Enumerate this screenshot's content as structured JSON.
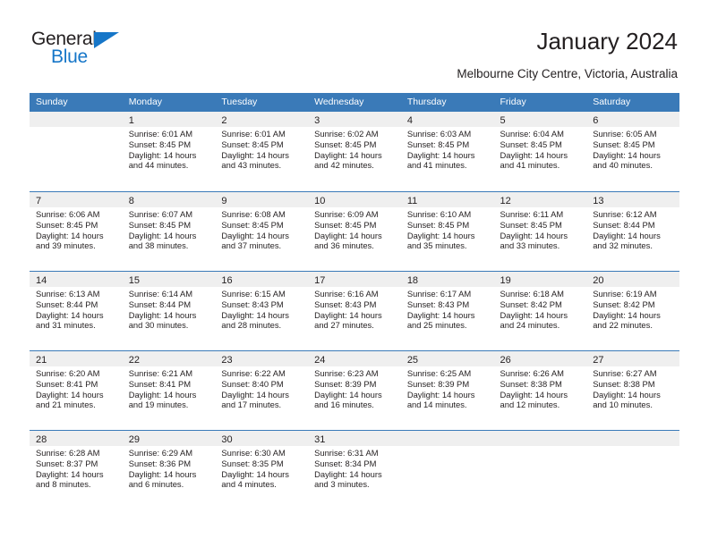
{
  "logo": {
    "word1": "General",
    "word2": "Blue",
    "triangle_color": "#1676c8",
    "word1_color": "#231f20",
    "word2_color": "#1676c8"
  },
  "header": {
    "title": "January 2024",
    "subtitle": "Melbourne City Centre, Victoria, Australia"
  },
  "theme": {
    "header_bar_color": "#3a7ab8",
    "daynum_band_color": "#efefef",
    "text_color": "#231f20",
    "divider_color": "#3a7ab8"
  },
  "calendar": {
    "weekday_headers": [
      "Sunday",
      "Monday",
      "Tuesday",
      "Wednesday",
      "Thursday",
      "Friday",
      "Saturday"
    ],
    "weeks": [
      [
        {
          "day": "",
          "sunrise": "",
          "sunset": "",
          "daylight_line1": "",
          "daylight_line2": "",
          "empty": true
        },
        {
          "day": "1",
          "sunrise": "Sunrise: 6:01 AM",
          "sunset": "Sunset: 8:45 PM",
          "daylight_line1": "Daylight: 14 hours",
          "daylight_line2": "and 44 minutes."
        },
        {
          "day": "2",
          "sunrise": "Sunrise: 6:01 AM",
          "sunset": "Sunset: 8:45 PM",
          "daylight_line1": "Daylight: 14 hours",
          "daylight_line2": "and 43 minutes."
        },
        {
          "day": "3",
          "sunrise": "Sunrise: 6:02 AM",
          "sunset": "Sunset: 8:45 PM",
          "daylight_line1": "Daylight: 14 hours",
          "daylight_line2": "and 42 minutes."
        },
        {
          "day": "4",
          "sunrise": "Sunrise: 6:03 AM",
          "sunset": "Sunset: 8:45 PM",
          "daylight_line1": "Daylight: 14 hours",
          "daylight_line2": "and 41 minutes."
        },
        {
          "day": "5",
          "sunrise": "Sunrise: 6:04 AM",
          "sunset": "Sunset: 8:45 PM",
          "daylight_line1": "Daylight: 14 hours",
          "daylight_line2": "and 41 minutes."
        },
        {
          "day": "6",
          "sunrise": "Sunrise: 6:05 AM",
          "sunset": "Sunset: 8:45 PM",
          "daylight_line1": "Daylight: 14 hours",
          "daylight_line2": "and 40 minutes."
        }
      ],
      [
        {
          "day": "7",
          "sunrise": "Sunrise: 6:06 AM",
          "sunset": "Sunset: 8:45 PM",
          "daylight_line1": "Daylight: 14 hours",
          "daylight_line2": "and 39 minutes."
        },
        {
          "day": "8",
          "sunrise": "Sunrise: 6:07 AM",
          "sunset": "Sunset: 8:45 PM",
          "daylight_line1": "Daylight: 14 hours",
          "daylight_line2": "and 38 minutes."
        },
        {
          "day": "9",
          "sunrise": "Sunrise: 6:08 AM",
          "sunset": "Sunset: 8:45 PM",
          "daylight_line1": "Daylight: 14 hours",
          "daylight_line2": "and 37 minutes."
        },
        {
          "day": "10",
          "sunrise": "Sunrise: 6:09 AM",
          "sunset": "Sunset: 8:45 PM",
          "daylight_line1": "Daylight: 14 hours",
          "daylight_line2": "and 36 minutes."
        },
        {
          "day": "11",
          "sunrise": "Sunrise: 6:10 AM",
          "sunset": "Sunset: 8:45 PM",
          "daylight_line1": "Daylight: 14 hours",
          "daylight_line2": "and 35 minutes."
        },
        {
          "day": "12",
          "sunrise": "Sunrise: 6:11 AM",
          "sunset": "Sunset: 8:45 PM",
          "daylight_line1": "Daylight: 14 hours",
          "daylight_line2": "and 33 minutes."
        },
        {
          "day": "13",
          "sunrise": "Sunrise: 6:12 AM",
          "sunset": "Sunset: 8:44 PM",
          "daylight_line1": "Daylight: 14 hours",
          "daylight_line2": "and 32 minutes."
        }
      ],
      [
        {
          "day": "14",
          "sunrise": "Sunrise: 6:13 AM",
          "sunset": "Sunset: 8:44 PM",
          "daylight_line1": "Daylight: 14 hours",
          "daylight_line2": "and 31 minutes."
        },
        {
          "day": "15",
          "sunrise": "Sunrise: 6:14 AM",
          "sunset": "Sunset: 8:44 PM",
          "daylight_line1": "Daylight: 14 hours",
          "daylight_line2": "and 30 minutes."
        },
        {
          "day": "16",
          "sunrise": "Sunrise: 6:15 AM",
          "sunset": "Sunset: 8:43 PM",
          "daylight_line1": "Daylight: 14 hours",
          "daylight_line2": "and 28 minutes."
        },
        {
          "day": "17",
          "sunrise": "Sunrise: 6:16 AM",
          "sunset": "Sunset: 8:43 PM",
          "daylight_line1": "Daylight: 14 hours",
          "daylight_line2": "and 27 minutes."
        },
        {
          "day": "18",
          "sunrise": "Sunrise: 6:17 AM",
          "sunset": "Sunset: 8:43 PM",
          "daylight_line1": "Daylight: 14 hours",
          "daylight_line2": "and 25 minutes."
        },
        {
          "day": "19",
          "sunrise": "Sunrise: 6:18 AM",
          "sunset": "Sunset: 8:42 PM",
          "daylight_line1": "Daylight: 14 hours",
          "daylight_line2": "and 24 minutes."
        },
        {
          "day": "20",
          "sunrise": "Sunrise: 6:19 AM",
          "sunset": "Sunset: 8:42 PM",
          "daylight_line1": "Daylight: 14 hours",
          "daylight_line2": "and 22 minutes."
        }
      ],
      [
        {
          "day": "21",
          "sunrise": "Sunrise: 6:20 AM",
          "sunset": "Sunset: 8:41 PM",
          "daylight_line1": "Daylight: 14 hours",
          "daylight_line2": "and 21 minutes."
        },
        {
          "day": "22",
          "sunrise": "Sunrise: 6:21 AM",
          "sunset": "Sunset: 8:41 PM",
          "daylight_line1": "Daylight: 14 hours",
          "daylight_line2": "and 19 minutes."
        },
        {
          "day": "23",
          "sunrise": "Sunrise: 6:22 AM",
          "sunset": "Sunset: 8:40 PM",
          "daylight_line1": "Daylight: 14 hours",
          "daylight_line2": "and 17 minutes."
        },
        {
          "day": "24",
          "sunrise": "Sunrise: 6:23 AM",
          "sunset": "Sunset: 8:39 PM",
          "daylight_line1": "Daylight: 14 hours",
          "daylight_line2": "and 16 minutes."
        },
        {
          "day": "25",
          "sunrise": "Sunrise: 6:25 AM",
          "sunset": "Sunset: 8:39 PM",
          "daylight_line1": "Daylight: 14 hours",
          "daylight_line2": "and 14 minutes."
        },
        {
          "day": "26",
          "sunrise": "Sunrise: 6:26 AM",
          "sunset": "Sunset: 8:38 PM",
          "daylight_line1": "Daylight: 14 hours",
          "daylight_line2": "and 12 minutes."
        },
        {
          "day": "27",
          "sunrise": "Sunrise: 6:27 AM",
          "sunset": "Sunset: 8:38 PM",
          "daylight_line1": "Daylight: 14 hours",
          "daylight_line2": "and 10 minutes."
        }
      ],
      [
        {
          "day": "28",
          "sunrise": "Sunrise: 6:28 AM",
          "sunset": "Sunset: 8:37 PM",
          "daylight_line1": "Daylight: 14 hours",
          "daylight_line2": "and 8 minutes."
        },
        {
          "day": "29",
          "sunrise": "Sunrise: 6:29 AM",
          "sunset": "Sunset: 8:36 PM",
          "daylight_line1": "Daylight: 14 hours",
          "daylight_line2": "and 6 minutes."
        },
        {
          "day": "30",
          "sunrise": "Sunrise: 6:30 AM",
          "sunset": "Sunset: 8:35 PM",
          "daylight_line1": "Daylight: 14 hours",
          "daylight_line2": "and 4 minutes."
        },
        {
          "day": "31",
          "sunrise": "Sunrise: 6:31 AM",
          "sunset": "Sunset: 8:34 PM",
          "daylight_line1": "Daylight: 14 hours",
          "daylight_line2": "and 3 minutes."
        },
        {
          "day": "",
          "sunrise": "",
          "sunset": "",
          "daylight_line1": "",
          "daylight_line2": "",
          "empty": true
        },
        {
          "day": "",
          "sunrise": "",
          "sunset": "",
          "daylight_line1": "",
          "daylight_line2": "",
          "empty": true
        },
        {
          "day": "",
          "sunrise": "",
          "sunset": "",
          "daylight_line1": "",
          "daylight_line2": "",
          "empty": true
        }
      ]
    ]
  }
}
